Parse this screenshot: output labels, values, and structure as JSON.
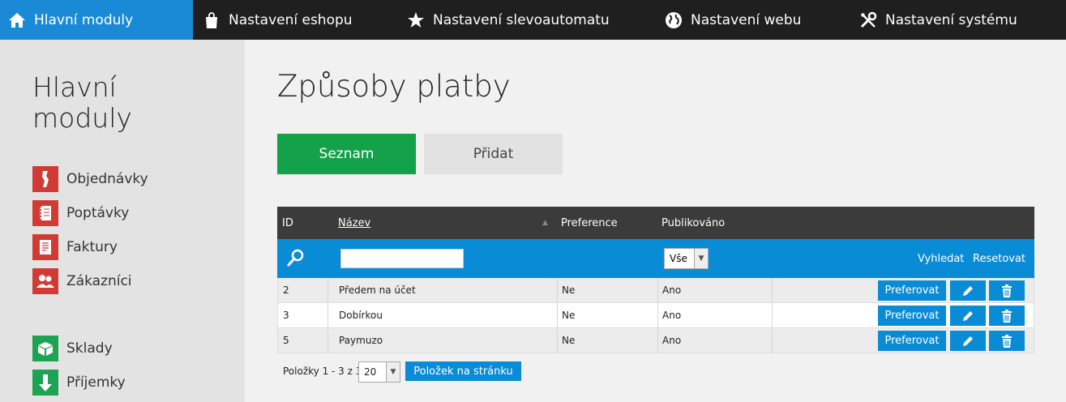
{
  "topnav": {
    "items": [
      {
        "label": "Hlavní moduly",
        "icon": "home-icon"
      },
      {
        "label": "Nastavení eshopu",
        "icon": "shopping-bag-icon"
      },
      {
        "label": "Nastavení slevoautomatu",
        "icon": "star-icon"
      },
      {
        "label": "Nastavení webu",
        "icon": "globe-icon"
      },
      {
        "label": "Nastavení systému",
        "icon": "tools-icon"
      }
    ],
    "active_color": "#1b8ad6"
  },
  "sidebar": {
    "title_line1": "Hlavní",
    "title_line2": "moduly",
    "items": [
      {
        "label": "Objednávky",
        "icon": "orders-icon"
      },
      {
        "label": "Poptávky",
        "icon": "notebook-icon"
      },
      {
        "label": "Faktury",
        "icon": "invoice-icon"
      },
      {
        "label": "Zákazníci",
        "icon": "customers-icon"
      },
      {
        "label": "Sklady",
        "icon": "box-icon"
      },
      {
        "label": "Příjemky",
        "icon": "arrow-down-icon"
      }
    ]
  },
  "main": {
    "title": "Způsoby platby",
    "tabs": {
      "list": "Seznam",
      "add": "Přidat"
    }
  },
  "table": {
    "headers": {
      "id": "ID",
      "name": "Název",
      "preference": "Preference",
      "published": "Publikováno"
    },
    "filter": {
      "name_value": "",
      "published_value": "Vše",
      "search": "Vyhledat",
      "reset": "Resetovat"
    },
    "rows": [
      {
        "id": "2",
        "name": "Předem na účet",
        "preference": "Ne",
        "published": "Ano",
        "action": "Preferovat"
      },
      {
        "id": "3",
        "name": "Dobírkou",
        "preference": "Ne",
        "published": "Ano",
        "action": "Preferovat"
      },
      {
        "id": "5",
        "name": "Paymuzo",
        "preference": "Ne",
        "published": "Ano",
        "action": "Preferovat"
      }
    ]
  },
  "pager": {
    "info": "Položky 1 - 3 z 3",
    "page_size": "20",
    "button": "Položek na stránku"
  }
}
